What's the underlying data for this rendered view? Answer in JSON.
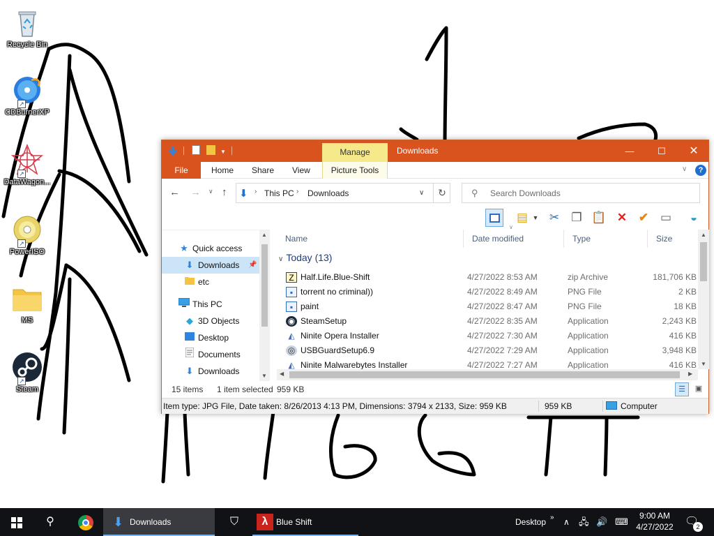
{
  "desktop": {
    "icons": [
      {
        "label": "Recycle Bin",
        "icon": "recycle-bin-icon"
      },
      {
        "label": "CDBurnerXP",
        "icon": "cd-burner-icon"
      },
      {
        "label": "DataWagon...",
        "icon": "datawagon-icon"
      },
      {
        "label": "PowerISO",
        "icon": "poweriso-icon"
      },
      {
        "label": "MS",
        "icon": "folder-icon"
      },
      {
        "label": "Steam",
        "icon": "steam-icon"
      }
    ]
  },
  "window": {
    "title": "Downloads",
    "manage_label": "Manage",
    "ribbon_tabs": {
      "file": "File",
      "home": "Home",
      "share": "Share",
      "view": "View",
      "picture_tools": "Picture Tools"
    },
    "address": {
      "this_pc": "This PC",
      "downloads": "Downloads"
    },
    "search": {
      "placeholder": "Search Downloads"
    },
    "nav_pane": [
      {
        "label": "Quick access",
        "icon": "star-icon"
      },
      {
        "label": "Downloads",
        "icon": "download-arrow-icon"
      },
      {
        "label": "etc",
        "icon": "folder-icon"
      },
      {
        "label": "This PC",
        "icon": "computer-icon"
      },
      {
        "label": "3D Objects",
        "icon": "cube-icon"
      },
      {
        "label": "Desktop",
        "icon": "desktop-icon"
      },
      {
        "label": "Documents",
        "icon": "document-icon"
      },
      {
        "label": "Downloads",
        "icon": "download-arrow-icon"
      }
    ],
    "columns": {
      "name": "Name",
      "date_modified": "Date modified",
      "type": "Type",
      "size": "Size"
    },
    "group_header": "Today (13)",
    "files": [
      {
        "name": "Half.Life.Blue-Shift",
        "date": "4/27/2022 8:53 AM",
        "type": "zip Archive",
        "size": "181,706 KB",
        "icon": "zip-icon"
      },
      {
        "name": "torrent no criminal))",
        "date": "4/27/2022 8:49 AM",
        "type": "PNG File",
        "size": "2 KB",
        "icon": "image-icon"
      },
      {
        "name": "paint",
        "date": "4/27/2022 8:47 AM",
        "type": "PNG File",
        "size": "18 KB",
        "icon": "image-icon"
      },
      {
        "name": "SteamSetup",
        "date": "4/27/2022 8:35 AM",
        "type": "Application",
        "size": "2,243 KB",
        "icon": "steam-icon"
      },
      {
        "name": "Ninite Opera Installer",
        "date": "4/27/2022 7:30 AM",
        "type": "Application",
        "size": "416 KB",
        "icon": "ninite-icon"
      },
      {
        "name": "USBGuardSetup6.9",
        "date": "4/27/2022 7:29 AM",
        "type": "Application",
        "size": "3,948 KB",
        "icon": "usb-guard-icon"
      },
      {
        "name": "Ninite Malwarebytes Installer",
        "date": "4/27/2022 7:27 AM",
        "type": "Application",
        "size": "416 KB",
        "icon": "ninite-icon"
      }
    ],
    "status": {
      "items": "15 items",
      "selected": "1 item selected",
      "selected_size": "959 KB"
    },
    "statusbar": {
      "info": "Item type: JPG File, Date taken: 8/26/2013 4:13 PM, Dimensions: 3794 x 2133, Size: 959 KB",
      "size": "959 KB",
      "location": "Computer"
    },
    "accent_color": "#d9531e"
  },
  "taskbar": {
    "downloads_label": "Downloads",
    "blueshift_label": "Blue Shift",
    "desktop_label": "Desktop",
    "time": "9:00 AM",
    "date": "4/27/2022",
    "notification_count": "2"
  }
}
